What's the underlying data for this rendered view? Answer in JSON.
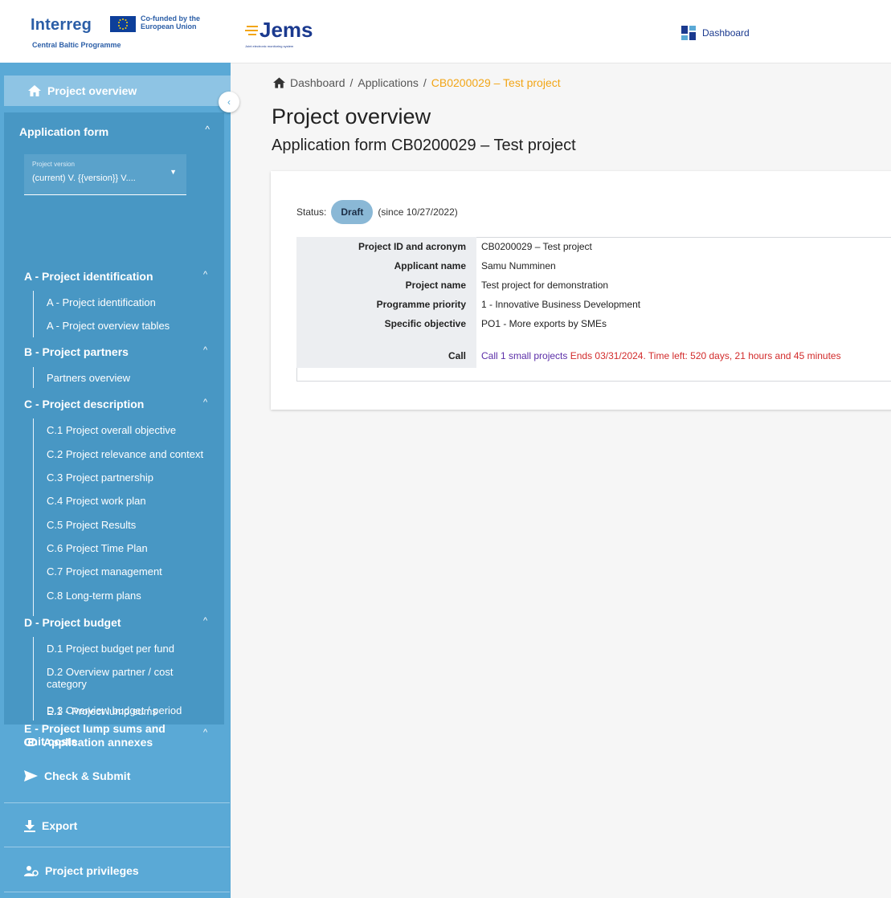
{
  "header": {
    "brand": "Interreg",
    "cofunded": "Co-funded by the European Union",
    "programme": "Central Baltic Programme",
    "app_name": "Jems",
    "app_subtitle": "Joint electronic monitoring system",
    "dashboard_label": "Dashboard"
  },
  "sidebar": {
    "project_overview": "Project overview",
    "application_form": {
      "title": "Application form",
      "version_label": "Project version",
      "version_value": "(current) V. {{version}} V....",
      "sections": [
        {
          "title": "A - Project identification",
          "items": [
            "A - Project identification",
            "A - Project overview tables"
          ]
        },
        {
          "title": "B - Project partners",
          "items": [
            "Partners overview"
          ]
        },
        {
          "title": "C - Project description",
          "items": [
            "C.1 Project overall objective",
            "C.2 Project relevance and context",
            "C.3 Project partnership",
            "C.4 Project work plan",
            "C.5 Project Results",
            "C.6 Project Time Plan",
            "C.7 Project management",
            "C.8 Long-term plans"
          ]
        },
        {
          "title": "D - Project budget",
          "items": [
            "D.1 Project budget per fund",
            "D.2 Overview partner / cost category",
            "D.3 Overview budget / period"
          ]
        },
        {
          "title": "E - Project lump sums and unit costs",
          "items": [
            "E.1 - Project lump sums"
          ]
        }
      ]
    },
    "application_annexes": "Application annexes",
    "check_submit": "Check & Submit",
    "export": "Export",
    "project_privileges": "Project privileges"
  },
  "breadcrumb": {
    "home": "Dashboard",
    "sep": "/",
    "applications": "Applications",
    "current": "CB0200029 – Test project"
  },
  "main": {
    "title": "Project overview",
    "subtitle": "Application form CB0200029 – Test project",
    "status_label": "Status:",
    "status_value": "Draft",
    "status_since": "(since 10/27/2022)",
    "rows": [
      {
        "label": "Project ID and acronym",
        "value": "CB0200029 – Test project"
      },
      {
        "label": "Applicant name",
        "value": "Samu Numminen"
      },
      {
        "label": "Project name",
        "value": "Test project for demonstration"
      },
      {
        "label": "Programme priority",
        "value": "1 - Innovative Business Development"
      },
      {
        "label": "Specific objective",
        "value": "PO1 - More exports by SMEs"
      }
    ],
    "call": {
      "label": "Call",
      "link": "Call 1 small projects",
      "ends": "Ends 03/31/2024. Time left: 520 days, 21 hours and 45 minutes"
    }
  },
  "colors": {
    "sidebar": "#5aa9d6",
    "sidebar_active": "#8ec4e4",
    "appform_bg": "#4897c4",
    "accent_orange": "#f2a516",
    "brand_blue": "#1b3a8f",
    "call_purple": "#5b2ea8",
    "ends_red": "#d22b2b"
  }
}
